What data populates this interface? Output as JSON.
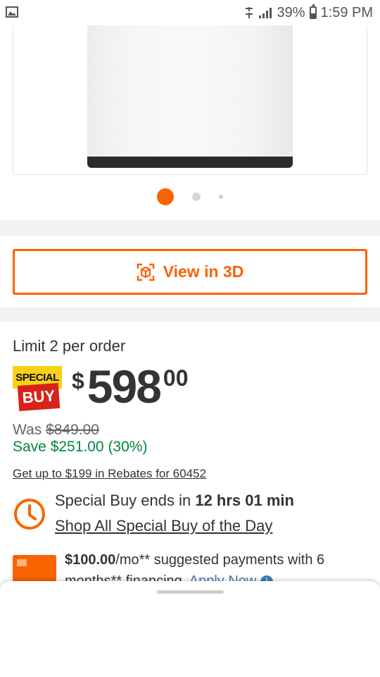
{
  "status_bar": {
    "battery": "39%",
    "time": "1:59 PM"
  },
  "carousel": {
    "active_index": 0,
    "count": 3
  },
  "view3d": {
    "label": "View in 3D"
  },
  "pricing": {
    "limit": "Limit 2 per order",
    "badge_top": "SPECIAL",
    "badge_bottom": "BUY",
    "currency": "$",
    "dollars": "598",
    "cents": "00",
    "was_label": "Was ",
    "was_price": "$849.00",
    "save": "Save $251.00 (30%)",
    "rebates": "Get up to $199 in Rebates for 60452"
  },
  "deal": {
    "prefix": "Special Buy ends in ",
    "timer": "12 hrs 01 min",
    "shop_link": "Shop All Special Buy of the Day"
  },
  "financing": {
    "amount": "$100.00",
    "text": "/mo** suggested payments with 6 months** financing. ",
    "apply": "Apply Now"
  },
  "colors": {
    "brand_orange": "#f96302",
    "save_green": "#00853e",
    "link_blue": "#3e7cb5",
    "badge_yellow": "#f7d117",
    "badge_red": "#d9221a"
  }
}
